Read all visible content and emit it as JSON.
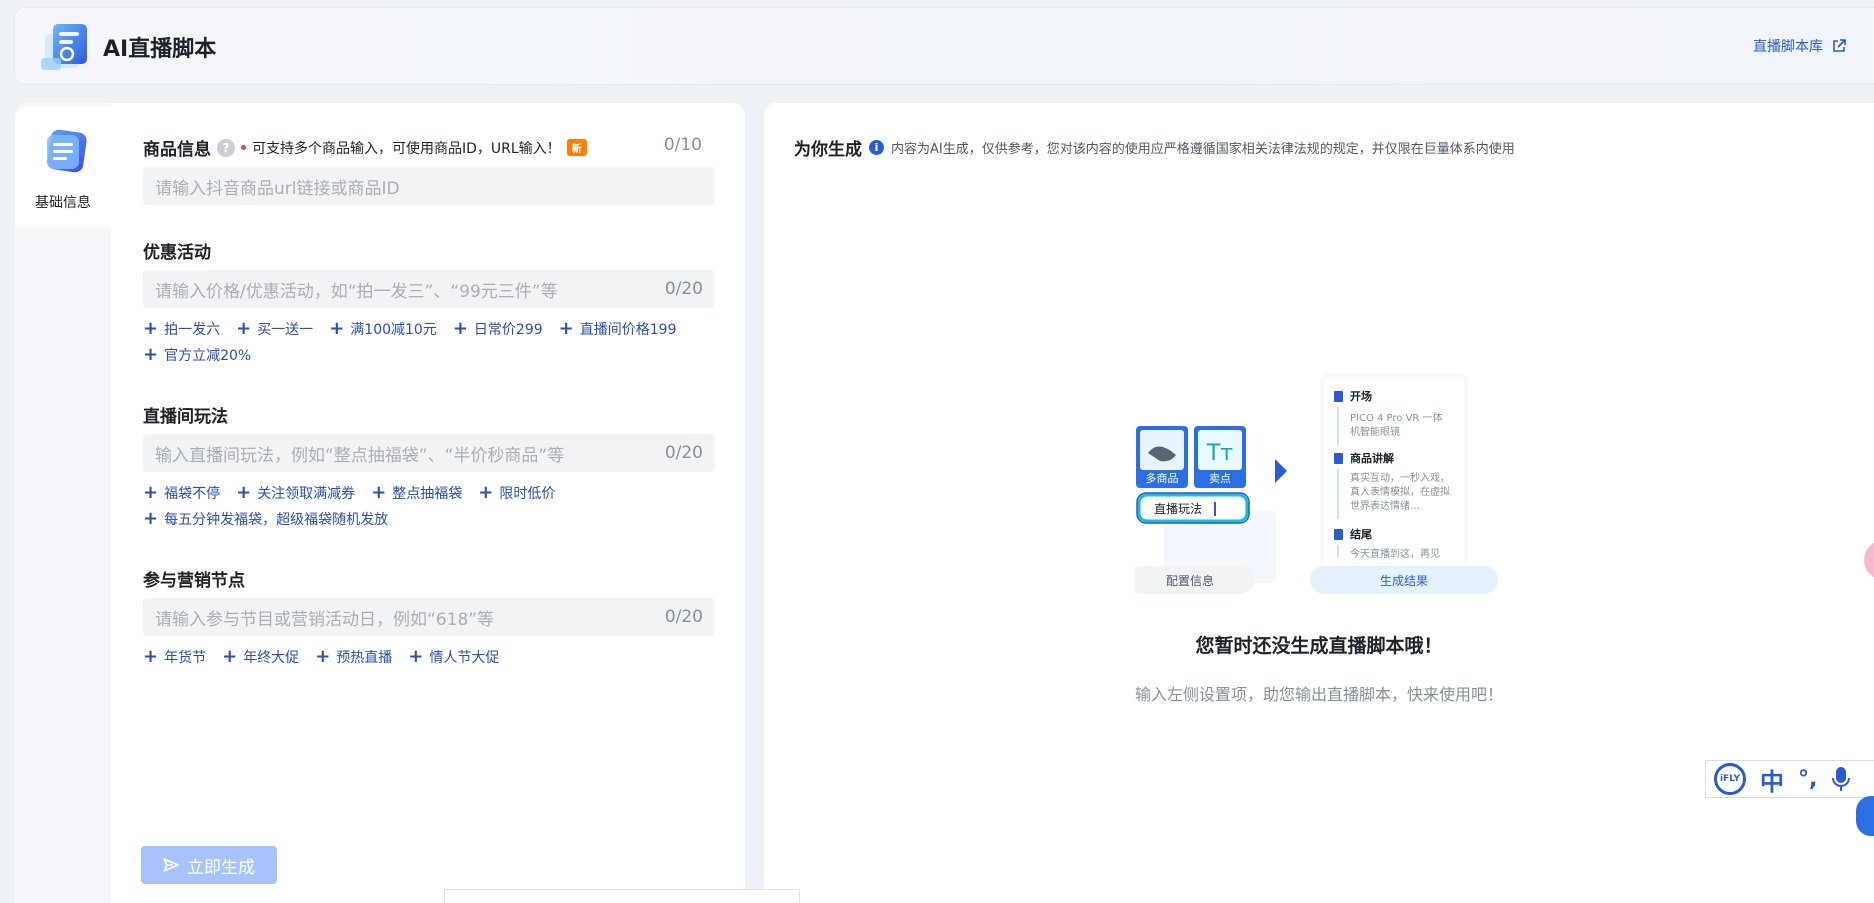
{
  "header": {
    "title": "AI直播脚本",
    "library_link": "直播脚本库"
  },
  "nav": {
    "items": [
      {
        "label": "基础信息"
      }
    ]
  },
  "form": {
    "product": {
      "title": "商品信息",
      "hint": "可支持多个商品输入，可使用商品ID，URL输入！",
      "badge": "新",
      "counter": "0/10",
      "placeholder": "请输入抖音商品url链接或商品ID"
    },
    "promo": {
      "title": "优惠活动",
      "placeholder": "请输入价格/优惠活动，如“拍一发三”、“99元三件”等",
      "counter": "0/20",
      "chips": [
        "拍一发六",
        "买一送一",
        "满100减10元",
        "日常价299",
        "直播间价格199",
        "官方立减20%"
      ]
    },
    "gameplay": {
      "title": "直播间玩法",
      "placeholder": "输入直播间玩法，例如“整点抽福袋”、“半价秒商品”等",
      "counter": "0/20",
      "chips": [
        "福袋不停",
        "关注领取满减券",
        "整点抽福袋",
        "限时低价",
        "每五分钟发福袋，超级福袋随机发放"
      ]
    },
    "marketing": {
      "title": "参与营销节点",
      "placeholder": "请输入参与节目或营销活动日，例如“618”等",
      "counter": "0/20",
      "chips": [
        "年货节",
        "年终大促",
        "预热直播",
        "情人节大促"
      ]
    },
    "generate_button": "立即生成"
  },
  "result": {
    "title": "为你生成",
    "note": "内容为AI生成，仅供参考，您对该内容的使用应严格遵循国家相关法律法规的规定，并仅限在巨量体系内使用",
    "illustration": {
      "card_multi": "多商品",
      "card_selling": "卖点",
      "card_selling_glyph": "Tт",
      "gameplay_label": "直播玩法",
      "config_label": "配置信息",
      "result_label": "生成结果",
      "sections": [
        {
          "title": "开场",
          "text1": "PICO 4 Pro VR 一体",
          "text2": "机智能眼镜"
        },
        {
          "title": "商品讲解",
          "text1": "真实互动，一秒入戏，",
          "text2": "真人表情模拟，在虚拟",
          "text3": "世界表达情绪…"
        },
        {
          "title": "结尾",
          "text1": "今天直播到这，再见"
        }
      ]
    },
    "empty_title": "您暂时还没生成直播脚本哦！",
    "empty_sub": "输入左侧设置项，助您输出直播脚本，快来使用吧！"
  },
  "ifly": {
    "logo": "iFLY",
    "lang": "中",
    "punct": "°,"
  },
  "colors": {
    "accent": "#2a5bd7",
    "chip": "#2a4db8",
    "disabled_button": "#a6c4fb",
    "badge": "#ff7d00"
  }
}
